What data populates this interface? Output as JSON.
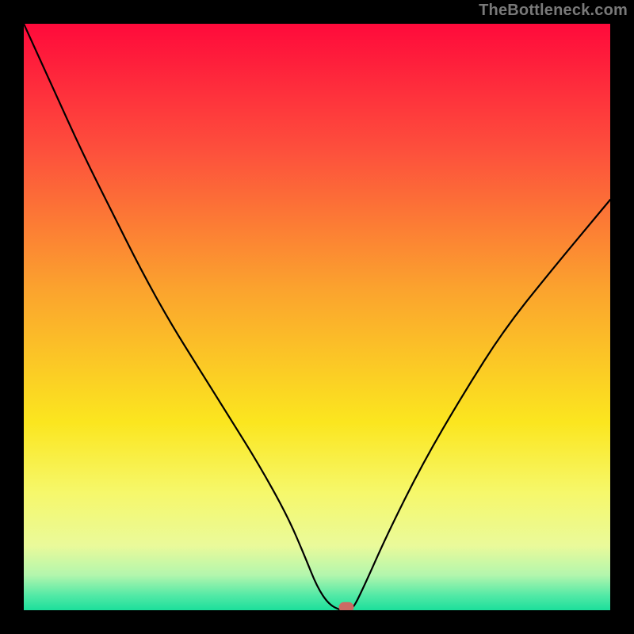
{
  "watermark": "TheBottleneck.com",
  "chart_data": {
    "type": "line",
    "title": "",
    "xlabel": "",
    "ylabel": "",
    "xlim": [
      0,
      100
    ],
    "ylim": [
      0,
      100
    ],
    "background_gradient": {
      "stops": [
        {
          "offset": 0.0,
          "color": "#FF0A3B"
        },
        {
          "offset": 0.22,
          "color": "#FD513C"
        },
        {
          "offset": 0.45,
          "color": "#FBA22E"
        },
        {
          "offset": 0.68,
          "color": "#FBE61F"
        },
        {
          "offset": 0.8,
          "color": "#F6F86B"
        },
        {
          "offset": 0.89,
          "color": "#EAFA9A"
        },
        {
          "offset": 0.94,
          "color": "#B3F6AD"
        },
        {
          "offset": 0.975,
          "color": "#52E9A6"
        },
        {
          "offset": 1.0,
          "color": "#1CDF9B"
        }
      ]
    },
    "series": [
      {
        "name": "bottleneck-curve",
        "x": [
          0,
          5,
          10,
          15,
          20,
          25,
          30,
          35,
          40,
          45,
          48,
          50,
          52,
          54,
          55,
          56,
          58,
          62,
          68,
          75,
          82,
          90,
          100
        ],
        "y": [
          100,
          89,
          78,
          68,
          58,
          49,
          41,
          33,
          25,
          16,
          9,
          4,
          1,
          0,
          0,
          0,
          4,
          13,
          25,
          37,
          48,
          58,
          70
        ]
      }
    ],
    "optimal_marker": {
      "x": 55,
      "y": 0.5,
      "color": "#CC6A64"
    }
  }
}
